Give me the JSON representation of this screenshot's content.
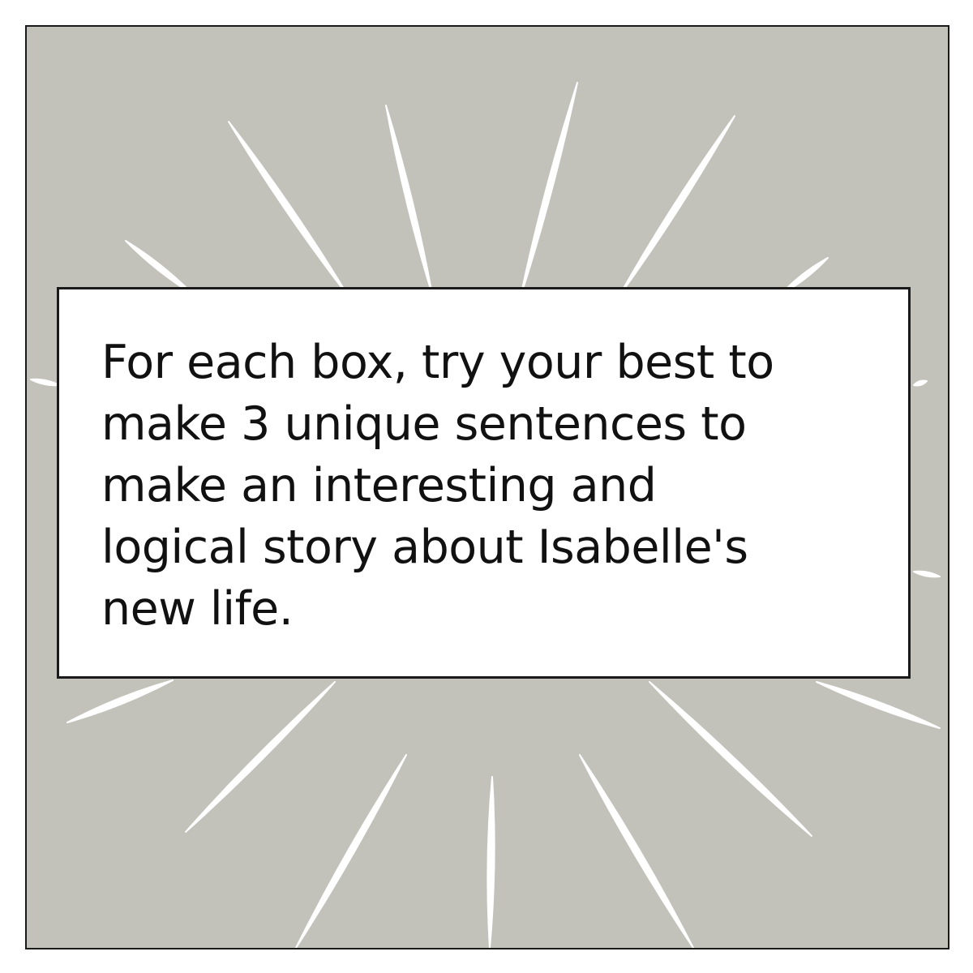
{
  "colors": {
    "background": "#c2c2bb",
    "rays": "#ffffff",
    "border": "#1a1a1a",
    "text": "#111111",
    "box": "#ffffff"
  },
  "decoration": {
    "name": "sunburst-rays"
  },
  "instruction": {
    "lines": [
      "For each box, try your best to",
      "make 3 unique sentences to",
      "make an interesting and",
      "logical story about Isabelle's",
      "new life."
    ]
  }
}
